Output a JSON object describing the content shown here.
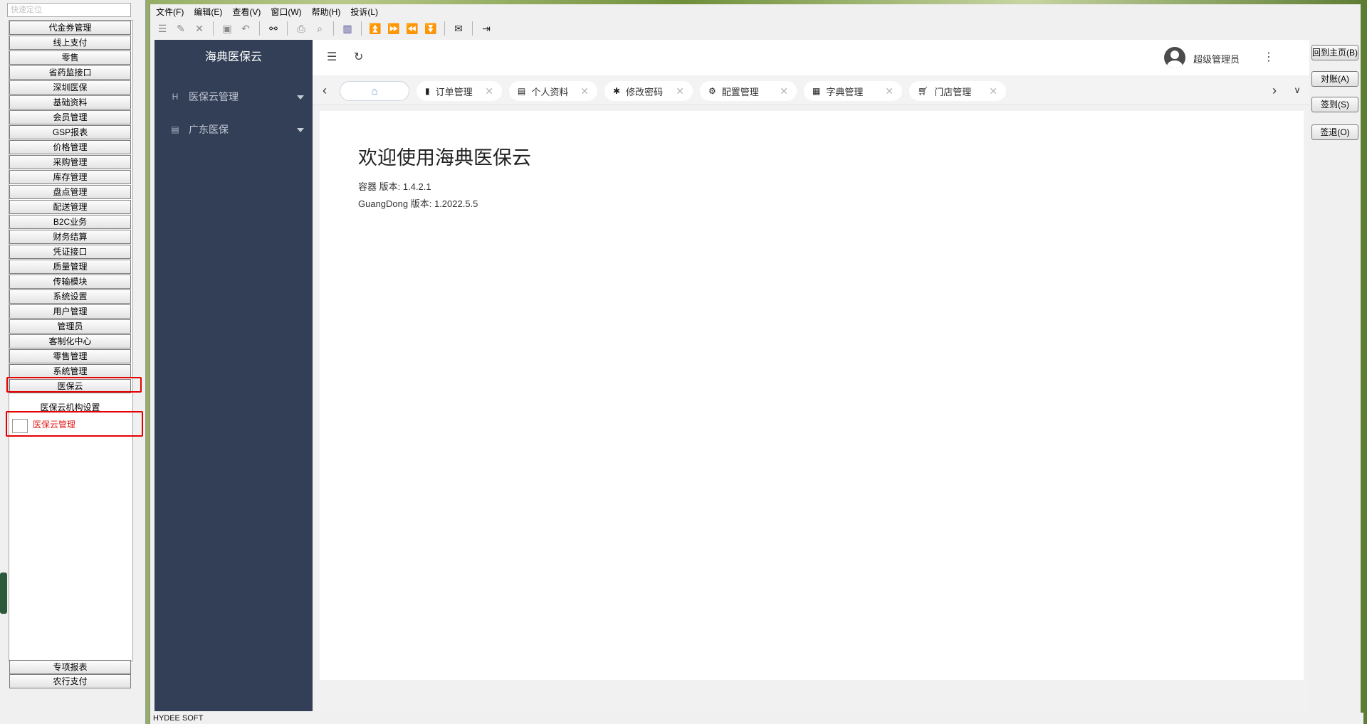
{
  "left_panel": {
    "search_placeholder": "快速定位",
    "nav_items": [
      "代金券管理",
      "线上支付",
      "零售",
      "省药监接口",
      "深圳医保",
      "基础资料",
      "会员管理",
      "GSP报表",
      "价格管理",
      "采购管理",
      "库存管理",
      "盘点管理",
      "配送管理",
      "B2C业务",
      "财务结算",
      "凭证接口",
      "质量管理",
      "传输模块",
      "系统设置",
      "用户管理",
      "管理员",
      "客制化中心",
      "零售管理",
      "系统管理",
      "医保云"
    ],
    "sub_items": [
      "医保云机构设置",
      "医保云管理"
    ],
    "bottom_items": [
      "专项报表",
      "农行支付"
    ],
    "highlight_color": "#e60000"
  },
  "menu_bar": [
    "文件(F)",
    "编辑(E)",
    "查看(V)",
    "窗口(W)",
    "帮助(H)",
    "投诉(L)"
  ],
  "toolbar": [
    "list-icon",
    "edit-icon",
    "delete-icon",
    "save-icon",
    "undo-icon",
    "binoculars-icon",
    "print-icon",
    "print-preview-icon",
    "chart-icon",
    "first-record-icon",
    "next-record-icon",
    "prev-record-icon",
    "last-record-icon",
    "mail-icon",
    "exit-icon"
  ],
  "web_app": {
    "brand": "海典医保云",
    "sidebar_color": "#323f56",
    "menus": [
      {
        "label": "医保云管理",
        "icon": "H"
      },
      {
        "label": "广东医保",
        "icon": "▤"
      }
    ],
    "user_name": "超级管理员",
    "tabs": [
      {
        "label": "订单管理",
        "icon": "book-icon"
      },
      {
        "label": "个人资料",
        "icon": "id-card-icon"
      },
      {
        "label": "修改密码",
        "icon": "asterisk-icon"
      },
      {
        "label": "配置管理",
        "icon": "cog-icon"
      },
      {
        "label": "字典管理",
        "icon": "list-alt-icon"
      },
      {
        "label": "门店管理",
        "icon": "cart-icon"
      }
    ],
    "welcome_title": "欢迎使用海典医保云",
    "versions": [
      "容器 版本: 1.4.2.1",
      "GuangDong 版本: 1.2022.5.5"
    ]
  },
  "side_buttons": [
    "回到主页(B)",
    "对账(A)",
    "签到(S)",
    "签退(O)"
  ],
  "status_text": "HYDEE SOFT"
}
